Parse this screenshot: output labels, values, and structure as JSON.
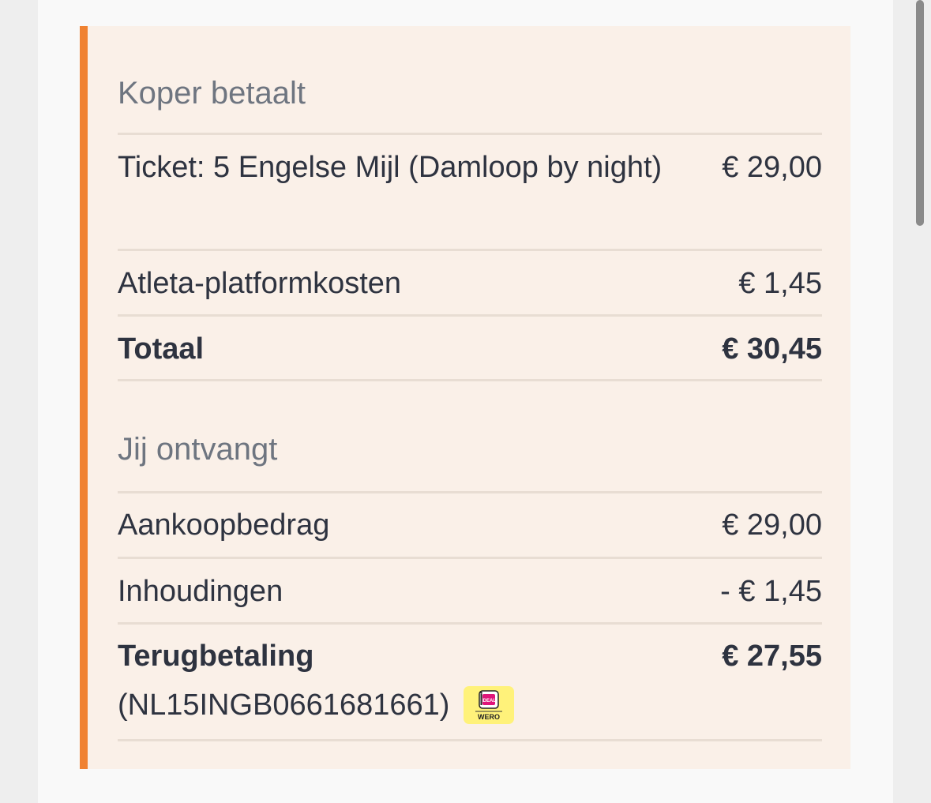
{
  "buyer_section": {
    "title": "Koper betaalt",
    "rows": [
      {
        "label": "Ticket: 5 Engelse Mijl (Damloop by night)",
        "amount": "€ 29,00"
      },
      {
        "label": "Atleta-platformkosten",
        "amount": "€ 1,45"
      }
    ],
    "total": {
      "label": "Totaal",
      "amount": "€ 30,45"
    }
  },
  "receive_section": {
    "title": "Jij ontvangt",
    "rows": [
      {
        "label": "Aankoopbedrag",
        "amount": "€ 29,00"
      },
      {
        "label": "Inhoudingen",
        "amount": "- € 1,45"
      }
    ],
    "total": {
      "label": "Terugbetaling",
      "amount": "€ 27,55",
      "iban": "(NL15INGB0661681661)"
    }
  },
  "payment_badge": {
    "icon": "ideal-wero-icon",
    "text": "WERO",
    "colors": {
      "badge": "#fff27a",
      "logo": "#e0157a"
    }
  },
  "colors": {
    "accent": "#f08232",
    "card_background": "#faf0e8",
    "divider": "#e8ddd3",
    "section_title": "#6e7580",
    "text": "#2e3340"
  }
}
